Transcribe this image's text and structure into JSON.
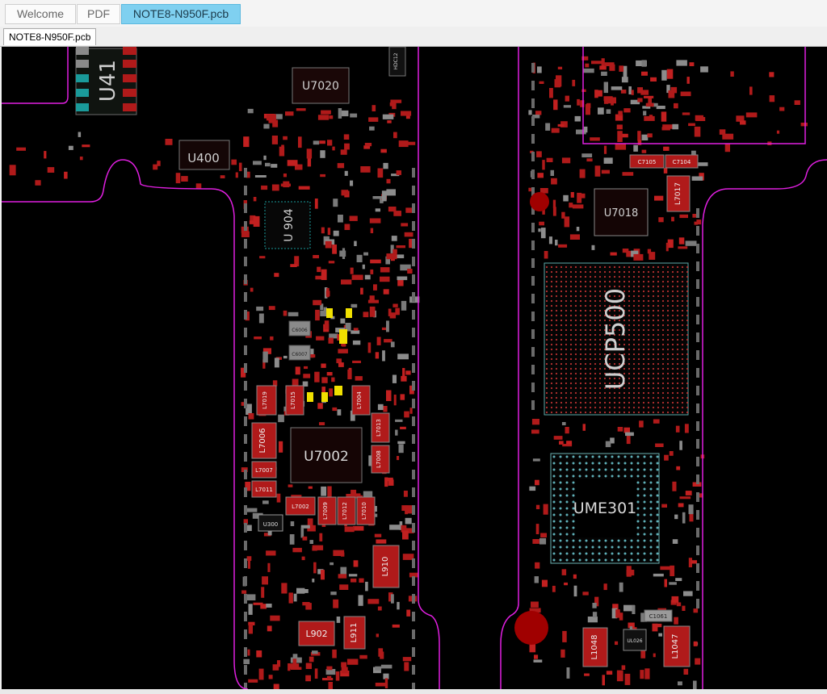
{
  "tabs": [
    {
      "label": "Welcome",
      "active": false
    },
    {
      "label": "PDF",
      "active": false
    },
    {
      "label": "NOTE8-N950F.pcb",
      "active": true
    }
  ],
  "document_tab": "NOTE8-N950F.pcb",
  "board": {
    "chips": [
      {
        "id": "u41",
        "label": "U41"
      },
      {
        "id": "u7020",
        "label": "U7020"
      },
      {
        "id": "u400",
        "label": "U400"
      },
      {
        "id": "u904",
        "label": "U 904"
      },
      {
        "id": "u7002",
        "label": "U7002"
      },
      {
        "id": "u7018",
        "label": "U7018"
      },
      {
        "id": "ucp500",
        "label": "UCP500"
      },
      {
        "id": "ume301",
        "label": "UME301"
      }
    ],
    "inductors": [
      {
        "id": "l910",
        "label": "L910"
      },
      {
        "id": "l902",
        "label": "L902"
      },
      {
        "id": "l911",
        "label": "L911"
      },
      {
        "id": "l7006",
        "label": "L7006"
      },
      {
        "id": "l1048",
        "label": "L1048"
      },
      {
        "id": "l1047",
        "label": "L1047"
      },
      {
        "id": "l7017",
        "label": "L7017"
      }
    ],
    "small_labels": [
      {
        "id": "c7105",
        "label": "C7105"
      },
      {
        "id": "c7104",
        "label": "C7104"
      },
      {
        "id": "c1061",
        "label": "C1061"
      },
      {
        "id": "ul026",
        "label": "UL026"
      },
      {
        "id": "l7007",
        "label": "L7007"
      },
      {
        "id": "l7011",
        "label": "L7011"
      },
      {
        "id": "l7002",
        "label": "L7002"
      },
      {
        "id": "l7008",
        "label": "L7008"
      },
      {
        "id": "l7013",
        "label": "L7013"
      },
      {
        "id": "l7019",
        "label": "L7019"
      },
      {
        "id": "l7015",
        "label": "L7015"
      },
      {
        "id": "l7004",
        "label": "L7004"
      },
      {
        "id": "l7009",
        "label": "L7009"
      },
      {
        "id": "l7012",
        "label": "L7012"
      },
      {
        "id": "l7010",
        "label": "L7010"
      },
      {
        "id": "u300",
        "label": "U300"
      },
      {
        "id": "c6006",
        "label": "C6006"
      },
      {
        "id": "c6007",
        "label": "C6007"
      },
      {
        "id": "hdc",
        "label": "HDC12"
      }
    ]
  }
}
